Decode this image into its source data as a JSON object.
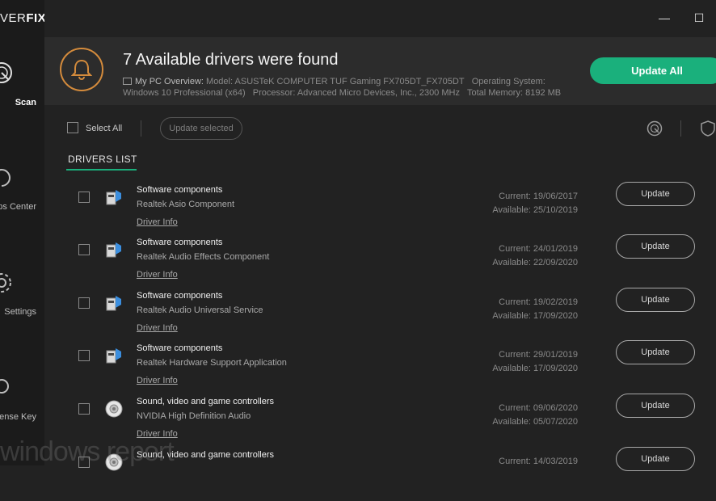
{
  "sidebar": {
    "brand_light": "VER",
    "brand_bold": "FIX",
    "items": [
      {
        "label": "Scan"
      },
      {
        "label": "Backups Center"
      },
      {
        "label": "Settings"
      },
      {
        "label": "License Key"
      }
    ]
  },
  "window": {
    "minimize": "—",
    "maximize": "☐"
  },
  "banner": {
    "title": "7 Available drivers were found",
    "overview_label": "My PC Overview:",
    "model_label": "Model:",
    "model_value": "ASUSTeK COMPUTER TUF Gaming FX705DT_FX705DT",
    "os_label": "Operating System:",
    "os_value": "Windows 10 Professional (x64)",
    "cpu_label": "Processor:",
    "cpu_value": "Advanced Micro Devices, Inc., 2300 MHz",
    "mem_label": "Total Memory:",
    "mem_value": "8192 MB",
    "update_all": "Update All"
  },
  "toolbar": {
    "select_all": "Select All",
    "update_selected": "Update selected"
  },
  "list": {
    "heading": "DRIVERS LIST",
    "rows": [
      {
        "category": "Software components",
        "name": "Realtek Asio Component",
        "info": "Driver Info",
        "current": "Current:  19/06/2017",
        "available": "Available:  25/10/2019",
        "button": "Update"
      },
      {
        "category": "Software components",
        "name": "Realtek Audio Effects Component",
        "info": "Driver Info",
        "current": "Current:  24/01/2019",
        "available": "Available:  22/09/2020",
        "button": "Update"
      },
      {
        "category": "Software components",
        "name": "Realtek Audio Universal Service",
        "info": "Driver Info",
        "current": "Current:  19/02/2019",
        "available": "Available:  17/09/2020",
        "button": "Update"
      },
      {
        "category": "Software components",
        "name": "Realtek Hardware Support Application",
        "info": "Driver Info",
        "current": "Current:  29/01/2019",
        "available": "Available:  17/09/2020",
        "button": "Update"
      },
      {
        "category": "Sound, video and game controllers",
        "name": "NVIDIA High Definition Audio",
        "info": "Driver Info",
        "current": "Current:  09/06/2020",
        "available": "Available:  05/07/2020",
        "button": "Update"
      },
      {
        "category": "Sound, video and game controllers",
        "name": "",
        "info": "",
        "current": "Current:  14/03/2019",
        "available": "",
        "button": "Update"
      }
    ]
  },
  "watermark": "windows report",
  "colors": {
    "accent": "#1ab07c",
    "bell": "#d48b3c",
    "background": "#222222"
  },
  "icons": [
    "scan-icon",
    "backups-icon",
    "settings-gear-icon",
    "key-icon",
    "bell-icon",
    "pc-icon",
    "scan-small-icon",
    "shield-icon",
    "software-component-icon",
    "speaker-icon"
  ]
}
